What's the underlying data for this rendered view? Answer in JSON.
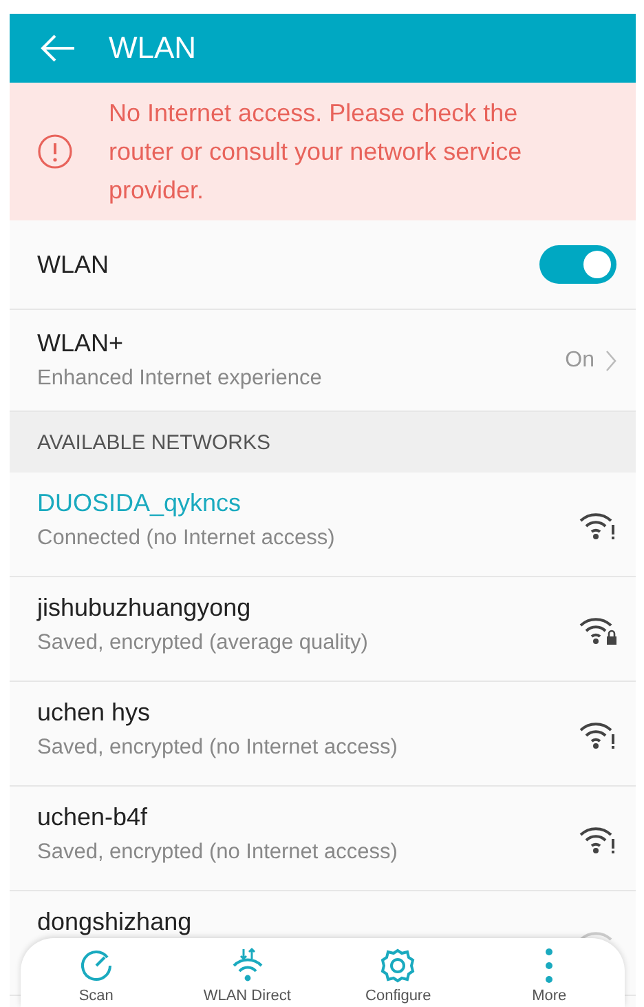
{
  "app_bar": {
    "title": "WLAN"
  },
  "alert": {
    "text": "No Internet access. Please check the router or consult your network service provider."
  },
  "settings": [
    {
      "kind": "switch",
      "label": "WLAN",
      "on": true
    },
    {
      "kind": "link",
      "label": "WLAN+",
      "subtitle": "Enhanced Internet experience",
      "value": "On"
    }
  ],
  "section_header": "AVAILABLE NETWORKS",
  "networks": [
    {
      "name": "DUOSIDA_qykncs",
      "status": "Connected (no Internet access)",
      "connected": true,
      "kind": "alert"
    },
    {
      "name": "jishubuzhuangyong",
      "status": "Saved, encrypted (average quality)",
      "connected": false,
      "kind": "lock"
    },
    {
      "name": "uchen hys",
      "status": "Saved, encrypted (no Internet access)",
      "connected": false,
      "kind": "alert"
    },
    {
      "name": "uchen-b4f",
      "status": "Saved, encrypted (no Internet access)",
      "connected": false,
      "kind": "alert"
    },
    {
      "name": "dongshizhang",
      "connected": false,
      "kind": "faded"
    }
  ],
  "bottom_bar": [
    {
      "kind": "scan",
      "label": "Scan"
    },
    {
      "kind": "direct",
      "label": "WLAN Direct"
    },
    {
      "kind": "configure",
      "label": "Configure"
    },
    {
      "kind": "more",
      "label": "More"
    }
  ]
}
